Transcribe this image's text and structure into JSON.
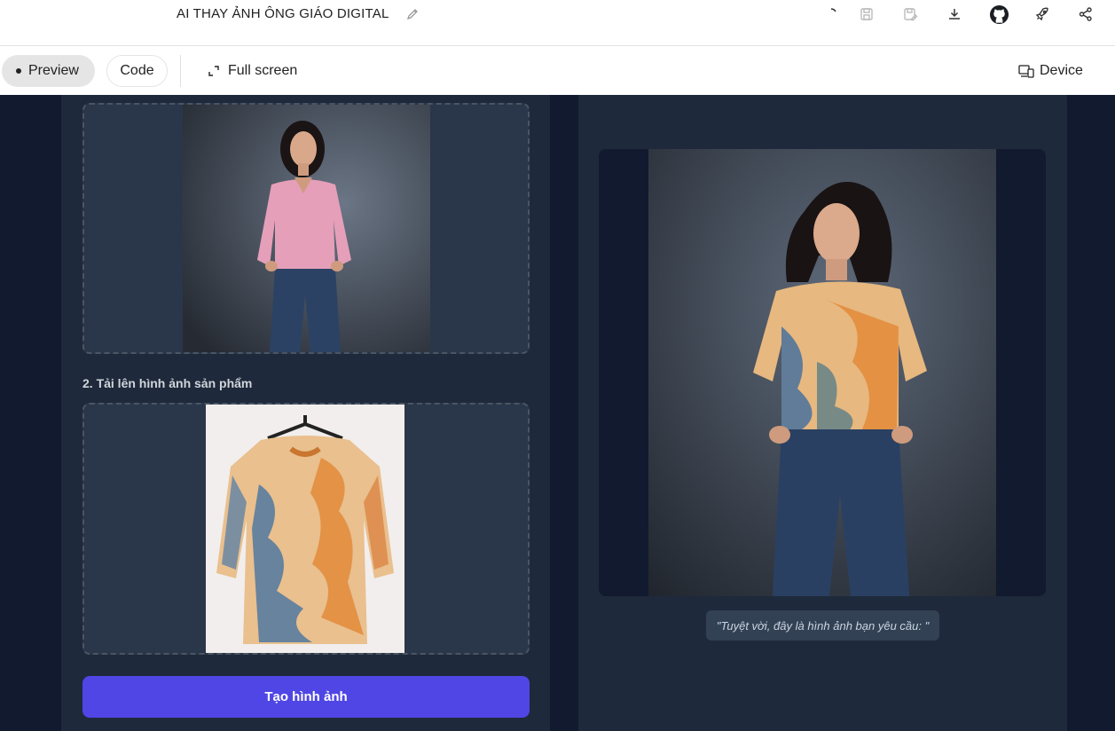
{
  "header": {
    "title": "AI THAY ẢNH ÔNG GIÁO DIGITAL",
    "icons": [
      "edit-icon",
      "loading-icon",
      "save-icon",
      "save-as-icon",
      "download-icon",
      "github-icon",
      "deploy-icon",
      "share-icon"
    ]
  },
  "toolbar": {
    "preview_label": "Preview",
    "code_label": "Code",
    "fullscreen_label": "Full screen",
    "device_label": "Device"
  },
  "left_panel": {
    "product_section_label": "2. Tải lên hình ảnh sản phẩm",
    "generate_button_label": "Tạo hình ảnh"
  },
  "right_panel": {
    "result_caption": "\"Tuyệt vời, đây là hình ảnh bạn yêu cầu: \""
  },
  "colors": {
    "canvas_bg": "#111a2e",
    "panel_bg": "#1e293b",
    "dropzone_bg": "#2a3649",
    "button_bg": "#4f46e5",
    "caption_bg": "#334155"
  }
}
